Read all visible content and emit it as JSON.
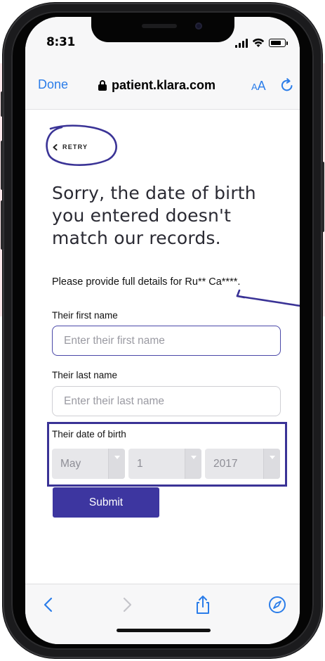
{
  "status_bar": {
    "time": "8:31"
  },
  "browser": {
    "done_label": "Done",
    "url": "patient.klara.com",
    "text_size_label_small": "A",
    "text_size_label_large": "A"
  },
  "page": {
    "retry_label": "RETRY",
    "heading": "Sorry, the date of birth you entered doesn't match our records.",
    "provide_details": "Please provide full details for Ru** Ca****.",
    "first_name": {
      "label": "Their first name",
      "placeholder": "Enter their first name",
      "value": ""
    },
    "last_name": {
      "label": "Their last name",
      "placeholder": "Enter their last name",
      "value": ""
    },
    "dob": {
      "label": "Their date of birth",
      "month": "May",
      "day": "1",
      "year": "2017"
    },
    "submit_label": "Submit"
  },
  "colors": {
    "accent": "#3d36a0",
    "link_blue": "#2b7de9",
    "annotation_blue": "#3a3396"
  },
  "icons": {
    "toolbar": [
      "back-icon",
      "forward-icon",
      "share-icon",
      "compass-icon"
    ],
    "top": [
      "lock-icon",
      "reload-icon",
      "chevron-left-icon"
    ]
  }
}
